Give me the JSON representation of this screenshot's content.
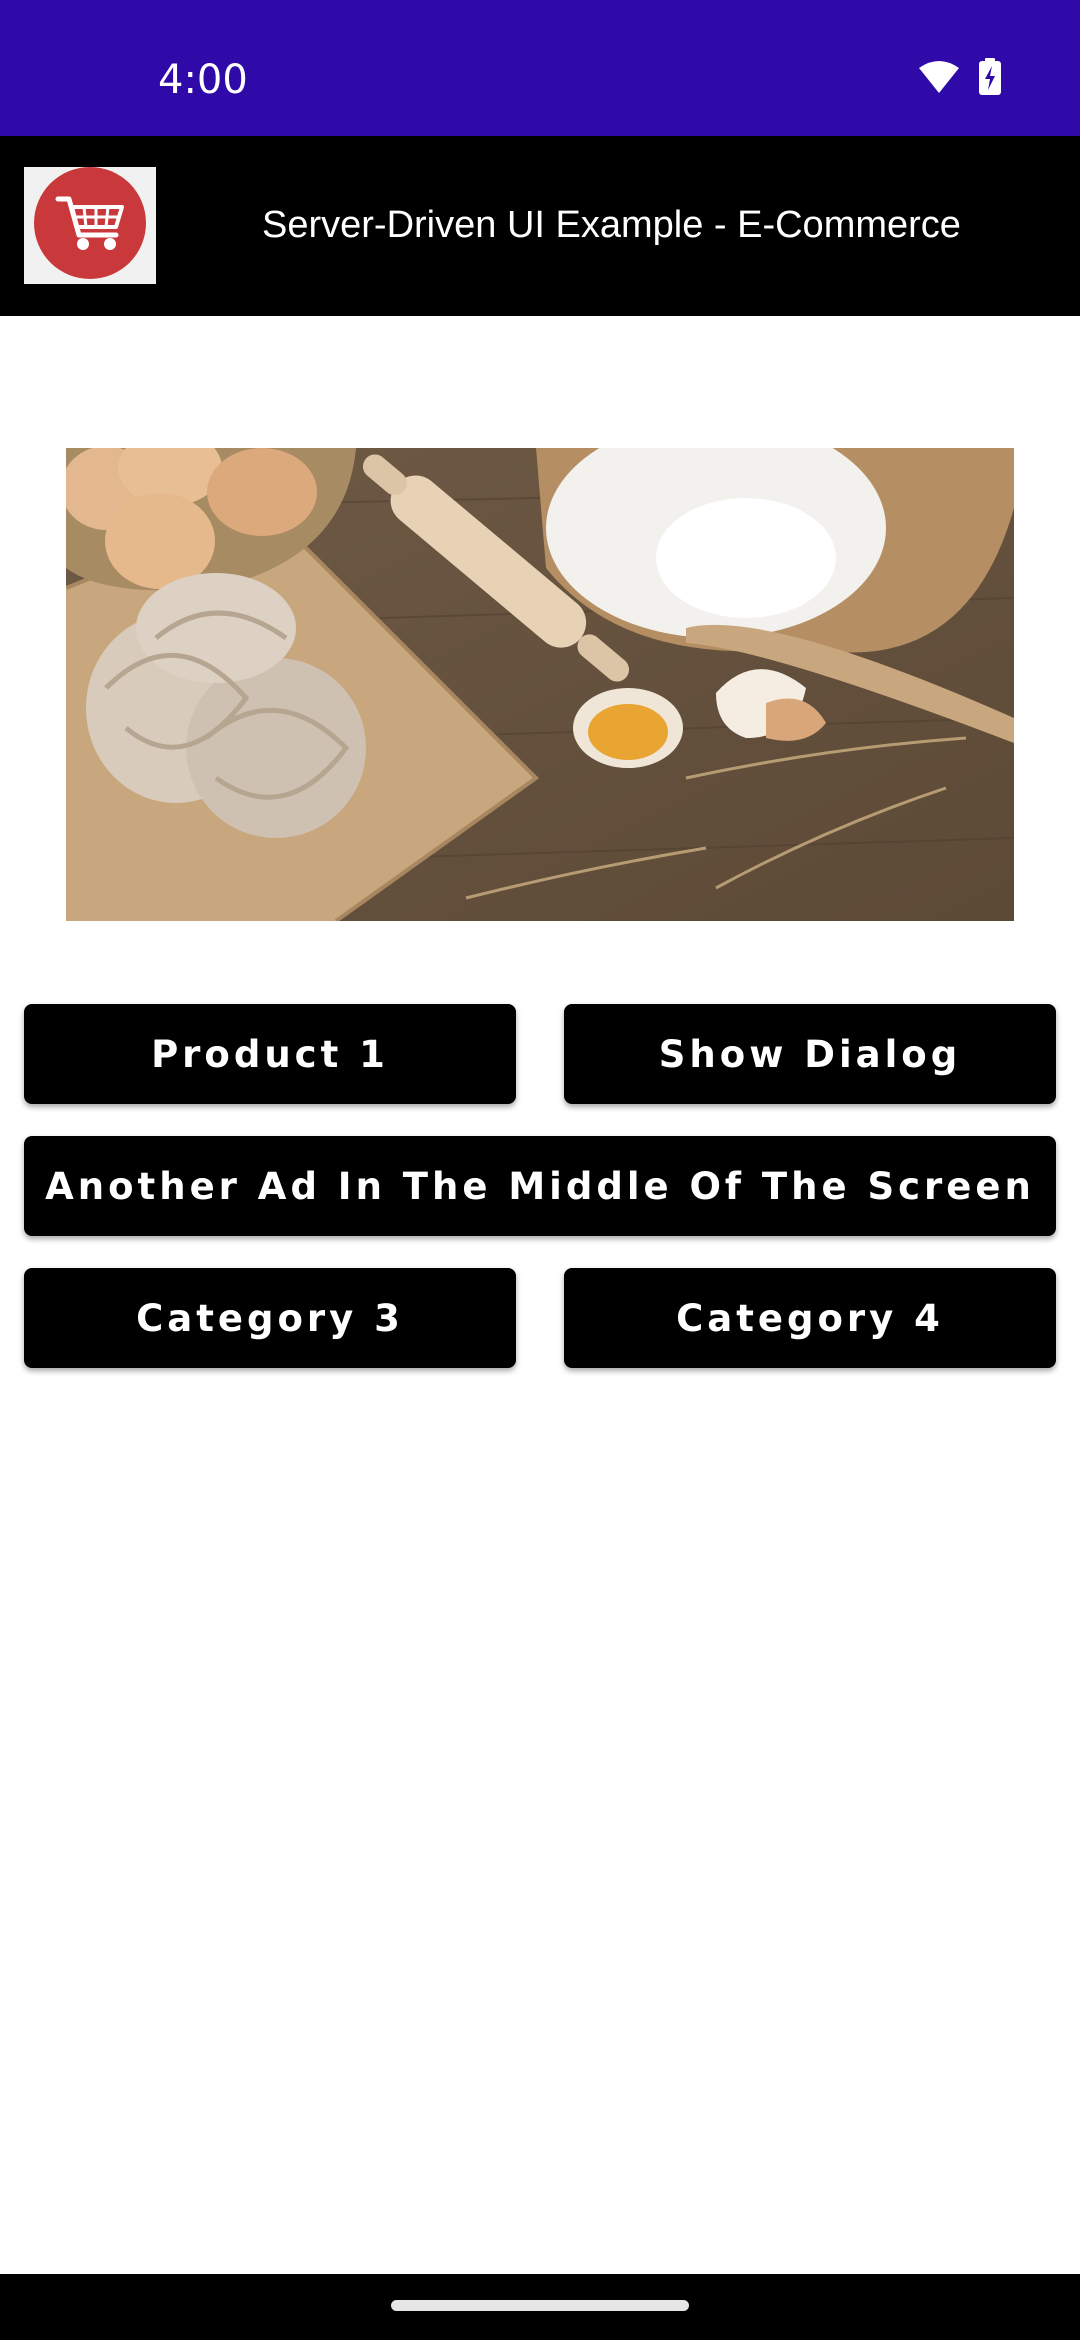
{
  "status_bar": {
    "time": "4:00",
    "icons": [
      "wifi-icon",
      "battery-charging-icon"
    ],
    "background": "#3009a9"
  },
  "app_bar": {
    "logo": "shopping-cart-icon",
    "title": "Server-Driven UI Example - E-Commerce",
    "background": "#000000"
  },
  "banner": {
    "image": "pasta-ingredients-photo"
  },
  "buttons": {
    "product_1": "Product 1",
    "show_dialog": "Show Dialog",
    "ad_middle": "Another Ad In The Middle Of The Screen",
    "category_3": "Category 3",
    "category_4": "Category 4"
  },
  "colors": {
    "button_bg": "#000000",
    "button_text": "#ffffff",
    "logo_red": "#c9393c"
  }
}
